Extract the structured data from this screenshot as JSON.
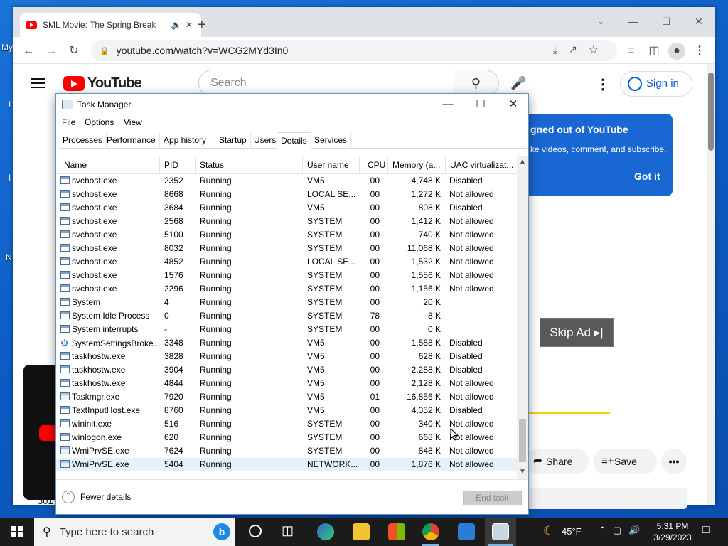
{
  "browser": {
    "tab_title": "SML Movie: The Spring Break",
    "new_tab": "+",
    "url": "youtube.com/watch?v=WCG2MYd3In0"
  },
  "youtube": {
    "logo_text": "YouTube",
    "search_placeholder": "Search",
    "sign_in": "Sign in",
    "popup_title": "gned out of YouTube",
    "popup_body": "ke videos, comment, and subscribe.",
    "popup_button": "Got it",
    "skip_ad": "Skip Ad ▸|",
    "share": "Share",
    "save": "Save",
    "more": "•••",
    "thumb_count": "301"
  },
  "desktop": {
    "fragments": [
      "My",
      "I",
      "I",
      "N"
    ]
  },
  "task_manager": {
    "title": "Task Manager",
    "menu": [
      "File",
      "Options",
      "View"
    ],
    "tabs": [
      "Processes",
      "Performance",
      "App history",
      "Startup",
      "Users",
      "Details",
      "Services"
    ],
    "active_tab": "Details",
    "columns": [
      "Name",
      "PID",
      "Status",
      "User name",
      "CPU",
      "Memory (a...",
      "UAC virtualizat..."
    ],
    "rows": [
      {
        "icon": "svc",
        "name": "svchost.exe",
        "pid": "2352",
        "status": "Running",
        "user": "VM5",
        "cpu": "00",
        "mem": "4,748 K",
        "uac": "Disabled"
      },
      {
        "icon": "svc",
        "name": "svchost.exe",
        "pid": "8668",
        "status": "Running",
        "user": "LOCAL SE...",
        "cpu": "00",
        "mem": "1,272 K",
        "uac": "Not allowed"
      },
      {
        "icon": "svc",
        "name": "svchost.exe",
        "pid": "3684",
        "status": "Running",
        "user": "VM5",
        "cpu": "00",
        "mem": "808 K",
        "uac": "Disabled"
      },
      {
        "icon": "svc",
        "name": "svchost.exe",
        "pid": "2568",
        "status": "Running",
        "user": "SYSTEM",
        "cpu": "00",
        "mem": "1,412 K",
        "uac": "Not allowed"
      },
      {
        "icon": "svc",
        "name": "svchost.exe",
        "pid": "5100",
        "status": "Running",
        "user": "SYSTEM",
        "cpu": "00",
        "mem": "740 K",
        "uac": "Not allowed"
      },
      {
        "icon": "svc",
        "name": "svchost.exe",
        "pid": "8032",
        "status": "Running",
        "user": "SYSTEM",
        "cpu": "00",
        "mem": "11,068 K",
        "uac": "Not allowed"
      },
      {
        "icon": "svc",
        "name": "svchost.exe",
        "pid": "4852",
        "status": "Running",
        "user": "LOCAL SE...",
        "cpu": "00",
        "mem": "1,532 K",
        "uac": "Not allowed"
      },
      {
        "icon": "svc",
        "name": "svchost.exe",
        "pid": "1576",
        "status": "Running",
        "user": "SYSTEM",
        "cpu": "00",
        "mem": "1,556 K",
        "uac": "Not allowed"
      },
      {
        "icon": "svc",
        "name": "svchost.exe",
        "pid": "2296",
        "status": "Running",
        "user": "SYSTEM",
        "cpu": "00",
        "mem": "1,156 K",
        "uac": "Not allowed"
      },
      {
        "icon": "svc",
        "name": "System",
        "pid": "4",
        "status": "Running",
        "user": "SYSTEM",
        "cpu": "00",
        "mem": "20 K",
        "uac": ""
      },
      {
        "icon": "svc",
        "name": "System Idle Process",
        "pid": "0",
        "status": "Running",
        "user": "SYSTEM",
        "cpu": "78",
        "mem": "8 K",
        "uac": ""
      },
      {
        "icon": "svc",
        "name": "System interrupts",
        "pid": "-",
        "status": "Running",
        "user": "SYSTEM",
        "cpu": "00",
        "mem": "0 K",
        "uac": ""
      },
      {
        "icon": "gear",
        "name": "SystemSettingsBroke...",
        "pid": "3348",
        "status": "Running",
        "user": "VM5",
        "cpu": "00",
        "mem": "1,588 K",
        "uac": "Disabled"
      },
      {
        "icon": "svc",
        "name": "taskhostw.exe",
        "pid": "3828",
        "status": "Running",
        "user": "VM5",
        "cpu": "00",
        "mem": "628 K",
        "uac": "Disabled"
      },
      {
        "icon": "svc",
        "name": "taskhostw.exe",
        "pid": "3904",
        "status": "Running",
        "user": "VM5",
        "cpu": "00",
        "mem": "2,288 K",
        "uac": "Disabled"
      },
      {
        "icon": "svc",
        "name": "taskhostw.exe",
        "pid": "4844",
        "status": "Running",
        "user": "VM5",
        "cpu": "00",
        "mem": "2,128 K",
        "uac": "Not allowed"
      },
      {
        "icon": "tm",
        "name": "Taskmgr.exe",
        "pid": "7920",
        "status": "Running",
        "user": "VM5",
        "cpu": "01",
        "mem": "16,856 K",
        "uac": "Not allowed"
      },
      {
        "icon": "svc",
        "name": "TextInputHost.exe",
        "pid": "8760",
        "status": "Running",
        "user": "VM5",
        "cpu": "00",
        "mem": "4,352 K",
        "uac": "Disabled"
      },
      {
        "icon": "svc",
        "name": "wininit.exe",
        "pid": "516",
        "status": "Running",
        "user": "SYSTEM",
        "cpu": "00",
        "mem": "340 K",
        "uac": "Not allowed"
      },
      {
        "icon": "svc",
        "name": "winlogon.exe",
        "pid": "620",
        "status": "Running",
        "user": "SYSTEM",
        "cpu": "00",
        "mem": "668 K",
        "uac": "Not allowed"
      },
      {
        "icon": "tm",
        "name": "WmiPrvSE.exe",
        "pid": "7624",
        "status": "Running",
        "user": "SYSTEM",
        "cpu": "00",
        "mem": "848 K",
        "uac": "Not allowed"
      },
      {
        "icon": "tm",
        "name": "WmiPrvSE.exe",
        "pid": "5404",
        "status": "Running",
        "user": "NETWORK...",
        "cpu": "00",
        "mem": "1,876 K",
        "uac": "Not allowed",
        "selected": true
      }
    ],
    "fewer_details": "Fewer details",
    "end_task": "End task"
  },
  "taskbar": {
    "search_placeholder": "Type here to search",
    "temperature": "45°F",
    "time": "5:31 PM",
    "date": "3/29/2023"
  },
  "colors": {
    "accent": "#1967d2",
    "yt_red": "#ff0000",
    "selection": "#e5f1fb"
  }
}
